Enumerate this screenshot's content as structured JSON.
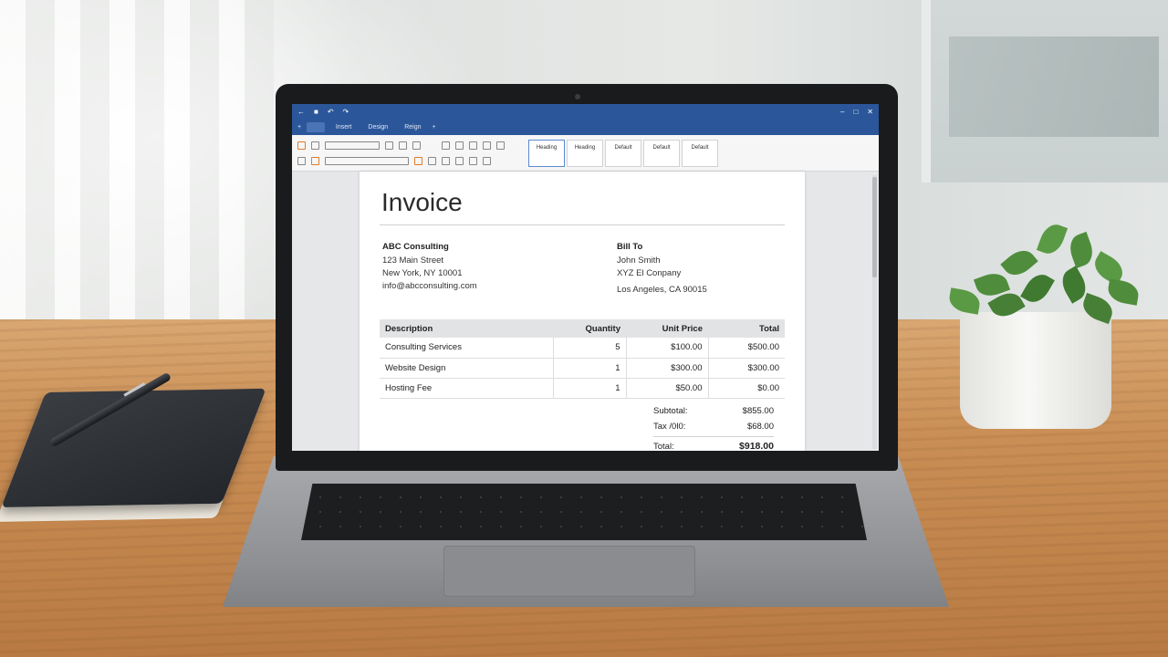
{
  "app": {
    "tabs": [
      "Insert",
      "Design",
      "Reign"
    ],
    "styles": [
      "Heading",
      "Heading",
      "Default",
      "Default",
      "Default"
    ]
  },
  "invoice": {
    "title": "Invoice",
    "from": {
      "name": "ABC Consulting",
      "street": "123 Main Street",
      "city": "New York, NY 10001",
      "email": "info@abcconsulting.com"
    },
    "bill_to": {
      "heading": "Bill To",
      "name": "John Smith",
      "company": "XYZ El Conpany",
      "city": "Los Angeles, CA 90015"
    },
    "table": {
      "headers": [
        "Description",
        "Quantity",
        "Unit Price",
        "Total"
      ],
      "rows": [
        [
          "Consulting Services",
          "5",
          "$100.00",
          "$500.00"
        ],
        [
          "Website Design",
          "1",
          "$300.00",
          "$300.00"
        ],
        [
          "Hosting Fee",
          "1",
          "$50.00",
          "$0.00"
        ]
      ]
    },
    "totals": {
      "subtotal_label": "Subtotal:",
      "subtotal": "$855.00",
      "tax_label": "Tax /0l0:",
      "tax": "$68.00",
      "total_label": "Total:",
      "total": "$918.00"
    }
  }
}
